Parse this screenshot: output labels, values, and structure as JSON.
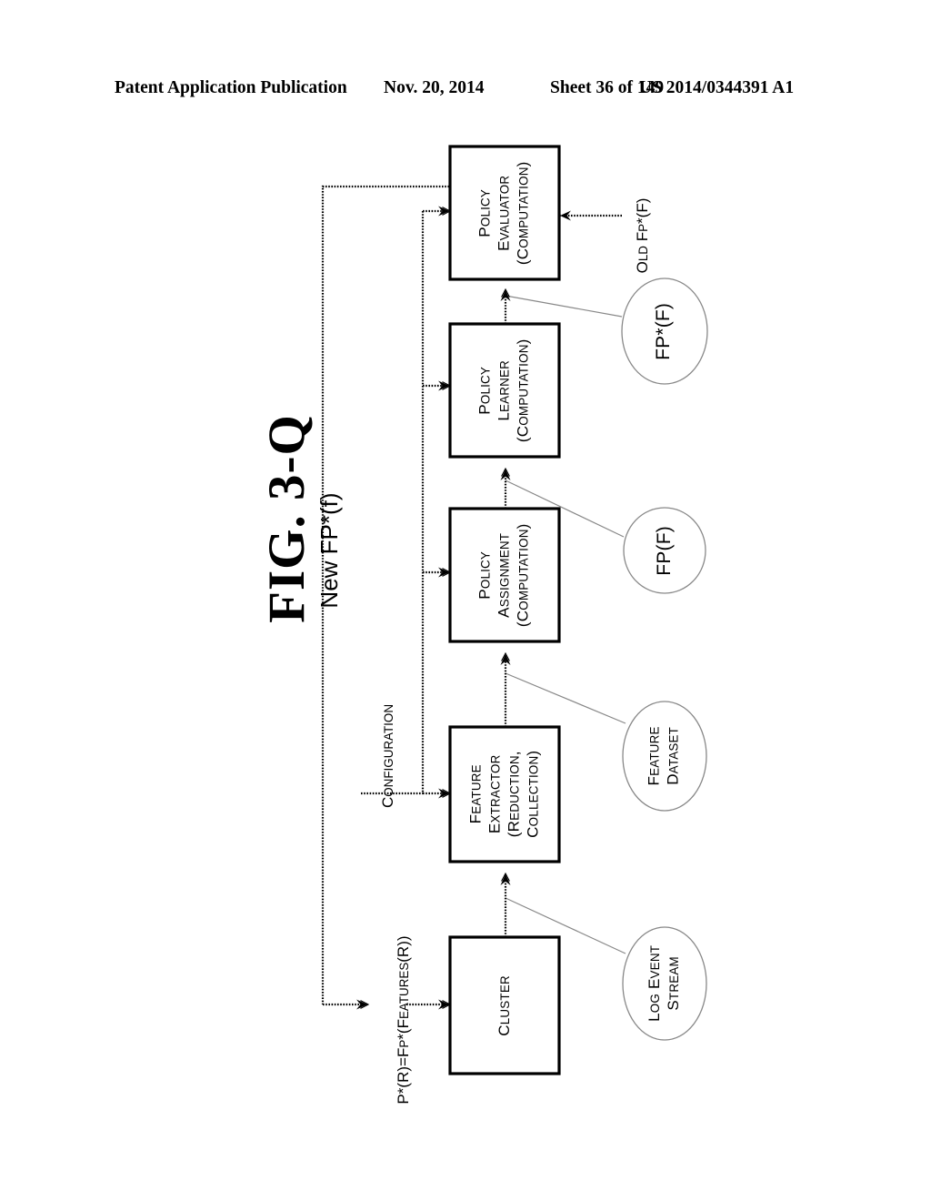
{
  "header": {
    "publication": "Patent Application Publication",
    "date": "Nov. 20, 2014",
    "sheet": "Sheet 36 of 149",
    "number": "US 2014/0344391 A1"
  },
  "figure": {
    "label": "FIG. 3-Q"
  },
  "diagram": {
    "boxes": [
      {
        "id": "policy-evaluator",
        "lines": [
          "Policy",
          "Evaluator",
          "(Computation)"
        ]
      },
      {
        "id": "policy-learner",
        "lines": [
          "Policy",
          "Learner",
          "(Computation)"
        ]
      },
      {
        "id": "policy-assignment",
        "lines": [
          "Policy",
          "Assignment",
          "(Computation)"
        ]
      },
      {
        "id": "feature-extractor",
        "lines": [
          "Feature",
          "Extractor",
          "(Reduction,",
          "Collection)"
        ]
      },
      {
        "id": "cluster",
        "lines": [
          "Cluster"
        ]
      }
    ],
    "ellipses": [
      {
        "id": "fp-star-f",
        "lines": [
          "FP*(F)"
        ],
        "style": "plain"
      },
      {
        "id": "fp-f",
        "lines": [
          "FP(F)"
        ],
        "style": "plain"
      },
      {
        "id": "feature-dataset",
        "lines": [
          "Feature",
          "Dataset"
        ],
        "style": "smallcaps"
      },
      {
        "id": "log-event-stream",
        "lines": [
          "Log Event",
          "Stream"
        ],
        "style": "smallcaps"
      }
    ],
    "edge_labels": [
      {
        "id": "new-fp-star",
        "text": "New FP*(f)",
        "style": "plain"
      },
      {
        "id": "configuration",
        "text": "Configuration",
        "style": "smallcaps"
      },
      {
        "id": "old-fp-star",
        "text": "Old FP*(F)",
        "style": "smallcaps"
      },
      {
        "id": "p-star-r",
        "text": "P*(r)=FP*(features(r))",
        "style": "smallcaps"
      }
    ]
  },
  "colors": {
    "ink": "#000000",
    "ellipse_stroke": "#777777",
    "page": "#ffffff"
  }
}
